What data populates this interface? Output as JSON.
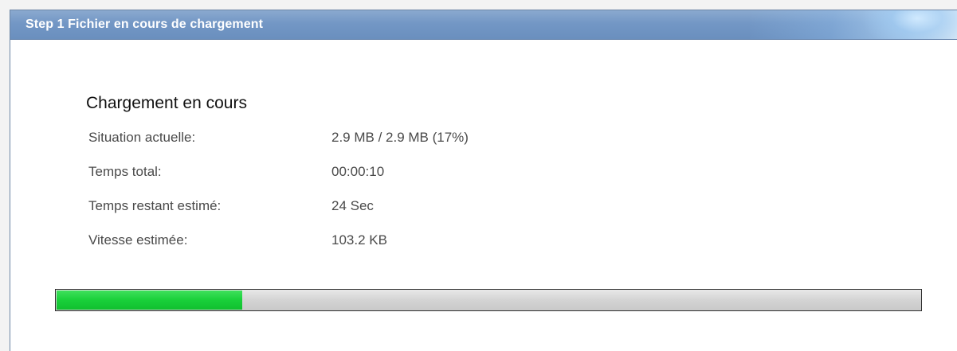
{
  "window": {
    "title": "Step 1 Fichier en cours de chargement"
  },
  "main": {
    "heading": "Chargement en cours",
    "rows": [
      {
        "label": "Situation actuelle:",
        "value": "2.9 MB / 2.9 MB (17%)"
      },
      {
        "label": "Temps total:",
        "value": "00:00:10"
      },
      {
        "label": "Temps restant estimé:",
        "value": "24 Sec"
      },
      {
        "label": "Vitesse estimée:",
        "value": "103.2 KB"
      }
    ]
  },
  "progress": {
    "fraction": 0.215
  },
  "colors": {
    "titlebar": "#7397c5",
    "progress_fill": "#19d03a",
    "progress_track": "#d4d4d4"
  }
}
